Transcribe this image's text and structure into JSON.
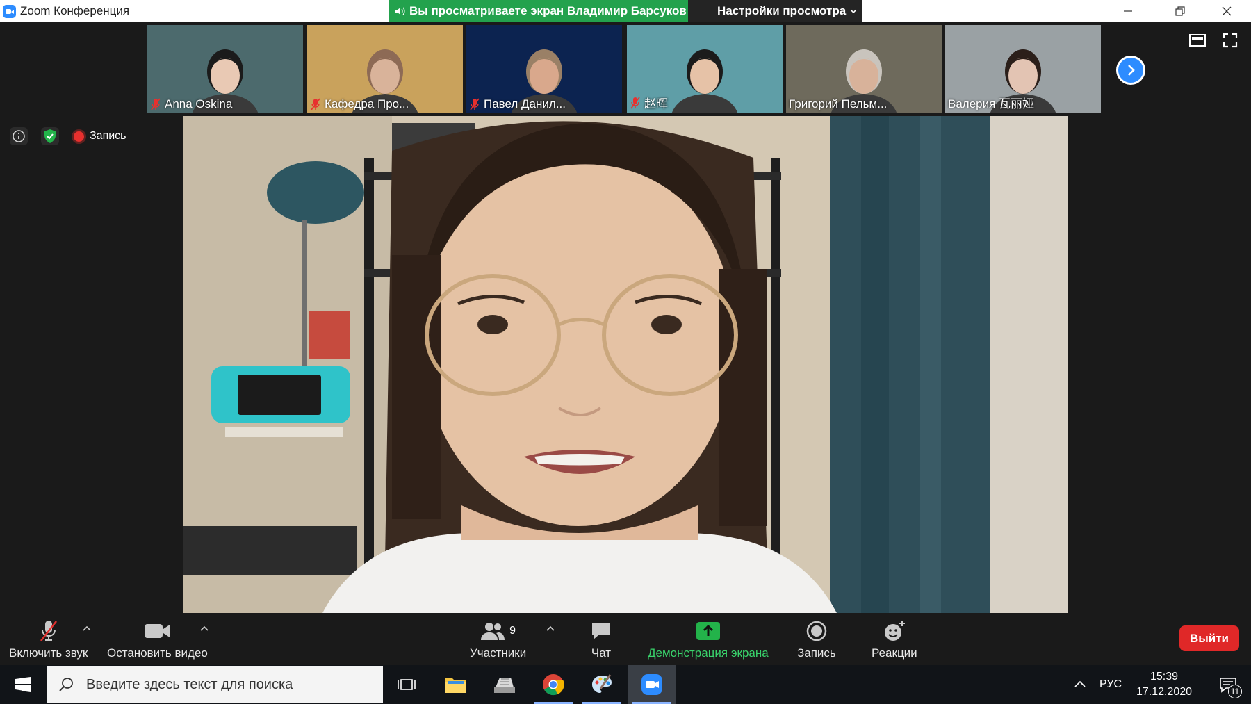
{
  "window": {
    "title": "Zoom Конференция",
    "share_banner": "Вы просматриваете экран Владимир Барсуков",
    "view_settings": "Настройки просмотра"
  },
  "participants": [
    {
      "name": "Anna Oskina",
      "muted": true,
      "bg": "#4c6a6d",
      "skin": "#e9c9b4",
      "hair": "#1b1b1b"
    },
    {
      "name": "Кафедра Про...",
      "muted": true,
      "bg": "#c9a25c",
      "skin": "#d9b39a",
      "hair": "#8d6a55"
    },
    {
      "name": "Павел Данил...",
      "muted": true,
      "bg": "#0c2350",
      "skin": "#d9a88c",
      "hair": "#9a8066"
    },
    {
      "name": "赵晖",
      "muted": true,
      "bg": "#5f9ea7",
      "skin": "#e6c2a7",
      "hair": "#1b1b1b"
    },
    {
      "name": "Григорий Пельм...",
      "muted": false,
      "bg": "#6e6a5c",
      "skin": "#d8b29a",
      "hair": "#c9c4bd",
      "active": true
    },
    {
      "name": "Валерия 瓦丽娅",
      "muted": false,
      "bg": "#9aa1a4",
      "skin": "#e3c4b3",
      "hair": "#2b1f1a"
    }
  ],
  "status": {
    "recording_label": "Запись"
  },
  "toolbar": {
    "unmute": "Включить звук",
    "stop_video": "Остановить видео",
    "participants": "Участники",
    "participants_count": "9",
    "chat": "Чат",
    "share_screen": "Демонстрация экрана",
    "record": "Запись",
    "reactions": "Реакции",
    "leave": "Выйти"
  },
  "taskbar": {
    "search_placeholder": "Введите здесь текст для поиска",
    "language": "РУС",
    "time": "15:39",
    "date": "17.12.2020",
    "notifications": "11"
  },
  "colors": {
    "zoom_blue": "#2d8cff",
    "share_green": "#23a24d",
    "leave_red": "#e02828",
    "record_red": "#e8302e",
    "active_speaker": "#a4d53a"
  }
}
